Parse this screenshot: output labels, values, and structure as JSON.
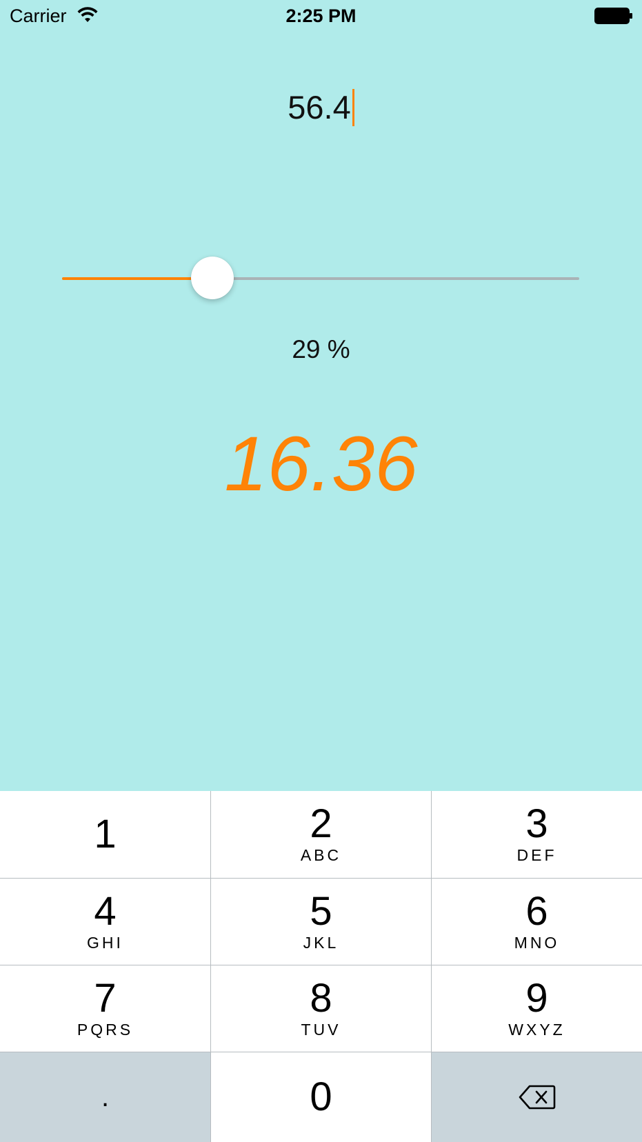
{
  "status_bar": {
    "carrier": "Carrier",
    "time": "2:25 PM"
  },
  "amount": {
    "value": "56.4"
  },
  "slider": {
    "fraction": 0.29,
    "fill_color": "#ff8306",
    "track_color": "#a9b3b6"
  },
  "percent_label": "29 %",
  "result": "16.36",
  "colors": {
    "background": "#b0ebea",
    "accent": "#ff8306"
  },
  "keypad": {
    "keys": [
      {
        "digit": "1",
        "letters": ""
      },
      {
        "digit": "2",
        "letters": "ABC"
      },
      {
        "digit": "3",
        "letters": "DEF"
      },
      {
        "digit": "4",
        "letters": "GHI"
      },
      {
        "digit": "5",
        "letters": "JKL"
      },
      {
        "digit": "6",
        "letters": "MNO"
      },
      {
        "digit": "7",
        "letters": "PQRS"
      },
      {
        "digit": "8",
        "letters": "TUV"
      },
      {
        "digit": "9",
        "letters": "WXYZ"
      },
      {
        "digit": ".",
        "letters": ""
      },
      {
        "digit": "0",
        "letters": ""
      }
    ],
    "delete_icon": "delete-backspace-icon"
  }
}
